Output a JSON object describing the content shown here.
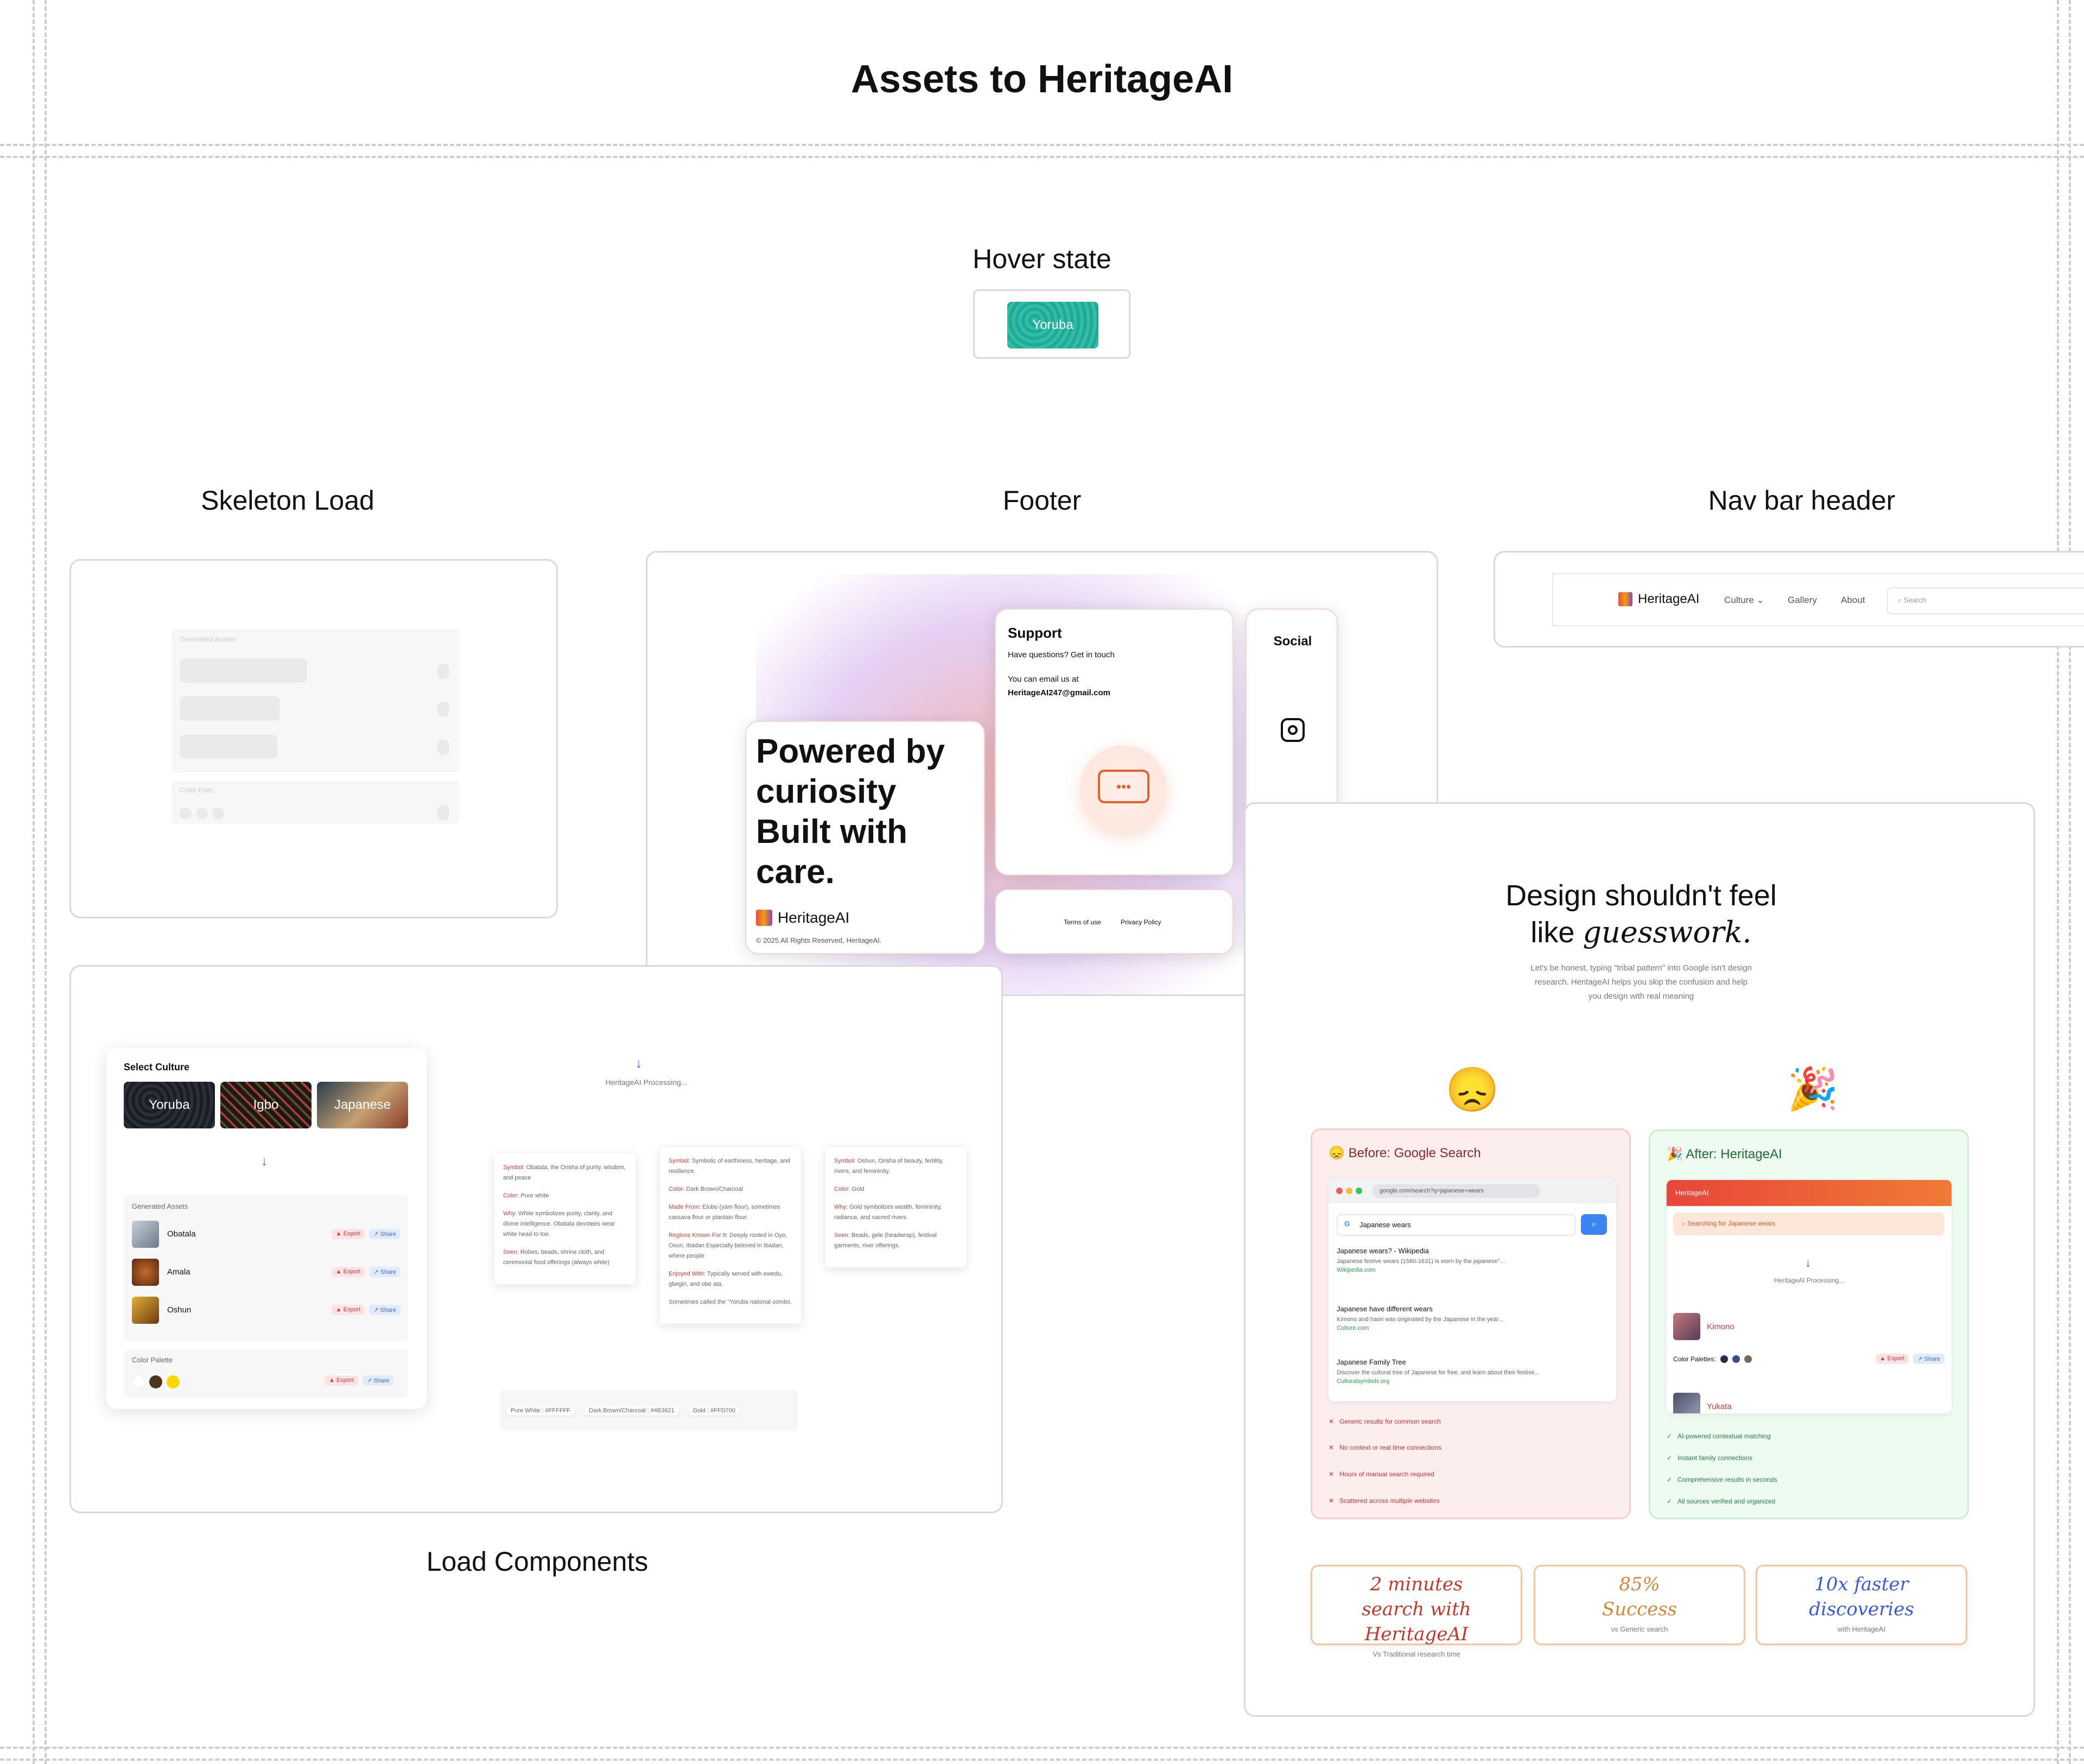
{
  "page_title": "Assets to HeritageAI",
  "sections": {
    "hover": "Hover state",
    "skeleton": "Skeleton Load",
    "footer": "Footer",
    "navbar": "Nav  bar header",
    "load": "Load Components"
  },
  "hover_chip": "Yoruba",
  "skeleton": {
    "label1": "Generated Assets",
    "label2": "Color Pale..."
  },
  "footer": {
    "headline": "Powered by curiosity Built with care.",
    "brand": "HeritageAI",
    "copyright": "© 2025 All Rights Reserved, HeritageAI.",
    "support_title": "Support",
    "support_q": "Have questions?  Get in touch",
    "email_label": "You can email us at",
    "email": "HeritageAI247@gmail.com",
    "terms": "Terms of use",
    "privacy": "Privacy Policy",
    "social_title": "Social"
  },
  "navbar": {
    "brand": "HeritageAI",
    "culture": "Culture",
    "gallery": "Gallery",
    "about": "About",
    "search_placeholder": "Search"
  },
  "load": {
    "select_culture": "Select Culture",
    "cultures": [
      "Yoruba",
      "Igbo",
      "Japanese"
    ],
    "generated_assets": "Generated Assets",
    "assets": [
      "Obatala",
      "Amala",
      "Oshun"
    ],
    "export": "Export",
    "share": "Share",
    "color_palette": "Color Palette",
    "processing": "HeritageAI Processing...",
    "note1": {
      "symbol": "Obatala, the Orisha of purity, wisdom, and peace",
      "color": "Pure white",
      "why": "White symbolizes purity, clarity, and divine intelligence. Obatala devotees wear white head to toe.",
      "seen": "Robes, beads, shrine cloth, and ceremonial food offerings (always white)"
    },
    "note2": {
      "symbol": "Symbolic of earthiness, heritage, and resilience.",
      "color": "Dark Brown/Charcoal",
      "made": "Elubo (yam flour), sometimes cassava flour or plantain flour.",
      "regions": "Deeply rooted in Oyo, Osun, Ibadan Especially beloved in Ibadan, where people",
      "enjoyed": "Typically served with ewedu, gbegiri, and obe ata.",
      "extra": "Sometimes called the \"Yoruba national combo."
    },
    "note3": {
      "symbol": "Oshun, Orisha of beauty, fertility, rivers, and femininity.",
      "color": "Gold",
      "why": "Gold symbolizes wealth, femininity, radiance, and sacred rivers.",
      "seen": "Beads, gele (headwrap), festival garments, river offerings."
    },
    "swatches": [
      "Pure White : #FFFFFF",
      "Dark Brown/Charcoal : #4B3621",
      "Gold : #FFD700"
    ]
  },
  "design": {
    "title_line1": "Design shouldn't feel",
    "title_like": "like",
    "title_italic": "guesswork.",
    "subtitle": "Let's be honest, typing \"tribal pattern\" into Google isn't design research. HeritageAI helps you skip the confusion and help you design with real meaning",
    "before_title": "Before: Google Search",
    "after_title": "After: HeritageAI",
    "url": "google.com/search?q=japanese+wears",
    "query": "Japanese wears",
    "results": [
      {
        "title": "Japanese wears? - Wikipedia",
        "desc": "Japanese festive wears (1580-1631) is worn by the japanese\"...",
        "link": "Wikipedia.com"
      },
      {
        "title": "Japanese have different wears",
        "desc": "Kimono and haori was originated by the Japanese in the year...",
        "link": "Culture.com"
      },
      {
        "title": "Japanese Family Tree",
        "desc": "Discover the cultural tree of Japanese for free, and learn about their festive...",
        "link": "Culturalsymbols.org"
      }
    ],
    "cons": [
      "Generic results for common search",
      "No context or real time connections",
      "Hours of manual search required",
      "Scattered across multiple websites"
    ],
    "pros": [
      "AI-powered contextual matching",
      "Instant family connections",
      "Comprehensive results in seconds",
      "All sources verified and organized"
    ],
    "after_app": "HeritageAI",
    "after_search": "Searching for Japanese wears",
    "after_processing": "HeritageAI Processing...",
    "kimono": "Kimono",
    "yukata": "Yukata",
    "palettes_label": "Color Palettes:",
    "stats": [
      {
        "big": "2 minutes search with HeritageAI",
        "sub": "Vs Traditional research time",
        "color": "#c0392b"
      },
      {
        "big": "85% Success",
        "sub": "vs Generic search",
        "color": "#d4883a"
      },
      {
        "big": "10x faster discoveries",
        "sub": "with HeritageAI",
        "color": "#3b5bd6"
      }
    ]
  }
}
